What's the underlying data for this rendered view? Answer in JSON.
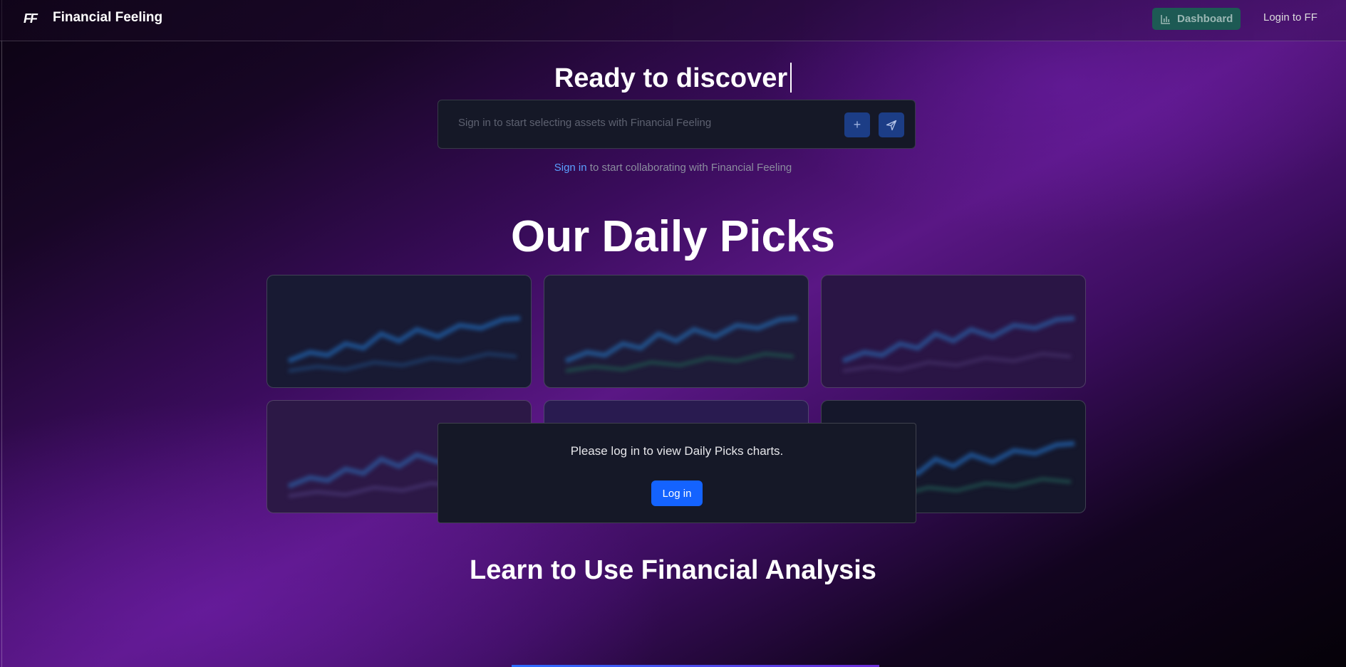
{
  "header": {
    "logo": "FF",
    "brand": "Financial Feeling",
    "dashboard_label": "Dashboard",
    "login_label": "Login to FF"
  },
  "hero": {
    "title": "Ready to discover",
    "search_placeholder": "Sign in to start selecting assets with Financial Feeling",
    "plus_icon": "+",
    "send_icon": "send-icon",
    "signin_link": "Sign in",
    "signin_note": " to start collaborating with Financial Feeling"
  },
  "picks": {
    "title": "Our Daily Picks",
    "cards": [
      "blurred-chart",
      "blurred-chart",
      "blurred-chart",
      "blurred-chart",
      "blurred-chart",
      "blurred-chart"
    ]
  },
  "login_modal": {
    "message": "Please log in to view Daily Picks charts.",
    "button_label": "Log in"
  },
  "learn": {
    "title": "Learn to Use Financial Analysis"
  },
  "colors": {
    "accent_blue": "#1463ff",
    "dashboard_bg": "#1d5a54",
    "link_blue": "#5aa0ff"
  }
}
